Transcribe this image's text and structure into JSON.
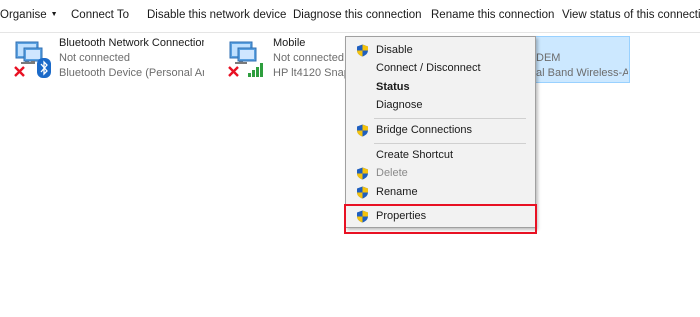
{
  "toolbar": {
    "organise": "Organise",
    "connect_to": "Connect To",
    "disable": "Disable this network device",
    "diagnose": "Diagnose this connection",
    "rename": "Rename this connection",
    "view_status": "View status of this connection"
  },
  "connections": [
    {
      "name": "Bluetooth Network Connection",
      "status": "Not connected",
      "device": "Bluetooth Device (Personal Ar..."
    },
    {
      "name": "Mobile",
      "status": "Not connected",
      "device": "HP lt4120 Snapd"
    },
    {
      "name_partial": "DEM",
      "device_partial": "al Band Wireless-A..."
    }
  ],
  "context_menu": {
    "items": [
      {
        "label": "Disable",
        "icon": "shield-icon"
      },
      {
        "label": "Connect / Disconnect"
      },
      {
        "label": "Status",
        "bold": true
      },
      {
        "label": "Diagnose"
      },
      {
        "label": "Bridge Connections",
        "icon": "shield-icon"
      },
      {
        "label": "Create Shortcut"
      },
      {
        "label": "Delete",
        "icon": "shield-icon",
        "disabled": true
      },
      {
        "label": "Rename",
        "icon": "shield-icon"
      },
      {
        "label": "Properties",
        "icon": "shield-icon"
      }
    ]
  },
  "colors": {
    "highlight_border": "#e81123",
    "selection_bg": "#cce8ff",
    "shield_blue": "#1f5fbf",
    "shield_yellow": "#f4c20d",
    "error_red": "#e81123",
    "bluetooth_blue": "#1b6ac9"
  }
}
